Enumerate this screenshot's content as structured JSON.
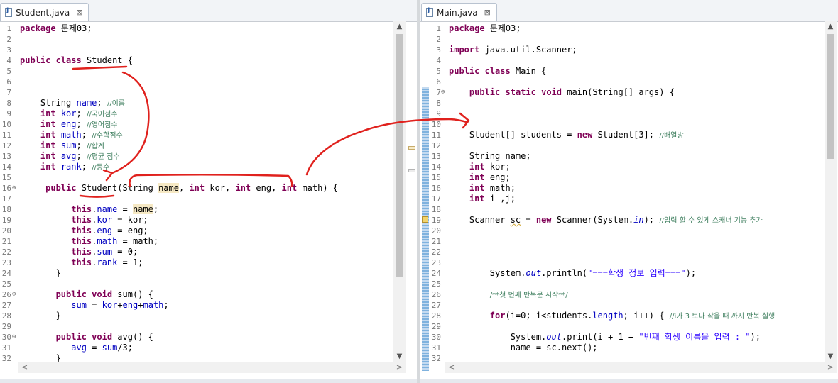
{
  "tabs": {
    "left": {
      "label": "Student.java",
      "close": "⊠"
    },
    "right": {
      "label": "Main.java",
      "close": "⊠"
    }
  },
  "icons": {
    "file": "java-file-icon",
    "close": "close-icon",
    "scroll_up": "▲",
    "scroll_down": "▼",
    "scroll_left": "<",
    "scroll_right": ">"
  },
  "colors": {
    "keyword": "#7f0055",
    "field": "#0000c0",
    "comment": "#3f7f5f",
    "string": "#2a00ff",
    "annotation": "#e0211d",
    "current_line": "#e8f2fe"
  },
  "left_editor": {
    "lines": [
      {
        "n": "1",
        "html": "<span class=\"kw\">package</span> 문제03;"
      },
      {
        "n": "2",
        "html": ""
      },
      {
        "n": "3",
        "html": ""
      },
      {
        "n": "4",
        "html": "<span class=\"kw\">public</span> <span class=\"kw\">class</span> Student {"
      },
      {
        "n": "5",
        "html": ""
      },
      {
        "n": "6",
        "html": ""
      },
      {
        "n": "7",
        "html": ""
      },
      {
        "n": "8",
        "html": "    String <span class=\"field\">name</span>; <span class=\"cmt\">//이름</span>"
      },
      {
        "n": "9",
        "html": "    <span class=\"kw\">int</span> <span class=\"field\">kor</span>; <span class=\"cmt\">//국어점수</span>"
      },
      {
        "n": "10",
        "html": "    <span class=\"kw\">int</span> <span class=\"field\">eng</span>; <span class=\"cmt\">//영어점수</span>"
      },
      {
        "n": "11",
        "html": "    <span class=\"kw\">int</span> <span class=\"field\">math</span>; <span class=\"cmt\">//수학점수</span>"
      },
      {
        "n": "12",
        "html": "    <span class=\"kw\">int</span> <span class=\"field\">sum</span>; <span class=\"cmt\">//합계</span>"
      },
      {
        "n": "13",
        "html": "    <span class=\"kw\">int</span> <span class=\"field\">avg</span>; <span class=\"cmt\">//평균 점수</span>"
      },
      {
        "n": "14",
        "html": "    <span class=\"kw\">int</span> <span class=\"field\">rank</span>; <span class=\"cmt\">//등수</span>"
      },
      {
        "n": "15",
        "html": ""
      },
      {
        "n": "16",
        "fold": "⊖",
        "html": "     <span class=\"kw\">public</span> Student(String <span class=\"occ\">name</span>, <span class=\"kw\">int</span> kor, <span class=\"kw\">int</span> eng, <span class=\"kw\">int</span> math) {"
      },
      {
        "n": "17",
        "html": ""
      },
      {
        "n": "18",
        "current": true,
        "html": "          <span class=\"kw\">this</span>.<span class=\"field\">name</span> = <span class=\"occ\">name</span>;"
      },
      {
        "n": "19",
        "html": "          <span class=\"kw\">this</span>.<span class=\"field\">kor</span> = kor;"
      },
      {
        "n": "20",
        "html": "          <span class=\"kw\">this</span>.<span class=\"field\">eng</span> = eng;"
      },
      {
        "n": "21",
        "html": "          <span class=\"kw\">this</span>.<span class=\"field\">math</span> = math;"
      },
      {
        "n": "22",
        "html": "          <span class=\"kw\">this</span>.<span class=\"field\">sum</span> = 0;"
      },
      {
        "n": "23",
        "html": "          <span class=\"kw\">this</span>.<span class=\"field\">rank</span> = 1;"
      },
      {
        "n": "24",
        "html": "       }"
      },
      {
        "n": "25",
        "html": ""
      },
      {
        "n": "26",
        "fold": "⊖",
        "html": "       <span class=\"kw\">public</span> <span class=\"kw\">void</span> sum() {"
      },
      {
        "n": "27",
        "html": "          <span class=\"field\">sum</span> = <span class=\"field\">kor</span>+<span class=\"field\">eng</span>+<span class=\"field\">math</span>;"
      },
      {
        "n": "28",
        "html": "       }"
      },
      {
        "n": "29",
        "html": ""
      },
      {
        "n": "30",
        "fold": "⊖",
        "html": "       <span class=\"kw\">public</span> <span class=\"kw\">void</span> avg() {"
      },
      {
        "n": "31",
        "html": "          <span class=\"field\">avg</span> = <span class=\"field\">sum</span>/3;"
      },
      {
        "n": "32",
        "html": "       }"
      }
    ]
  },
  "right_editor": {
    "lines": [
      {
        "n": "1",
        "html": "<span class=\"kw\">package</span> 문제03;"
      },
      {
        "n": "2",
        "html": ""
      },
      {
        "n": "3",
        "html": "<span class=\"kw\">import</span> java.util.Scanner;"
      },
      {
        "n": "4",
        "html": ""
      },
      {
        "n": "5",
        "html": "<span class=\"kw\">public</span> <span class=\"kw\">class</span> Main {"
      },
      {
        "n": "6",
        "html": ""
      },
      {
        "n": "7",
        "fold": "⊖",
        "html": "    <span class=\"kw\">public</span> <span class=\"kw\">static</span> <span class=\"kw\">void</span> main(String[] args) {"
      },
      {
        "n": "8",
        "html": ""
      },
      {
        "n": "9",
        "html": ""
      },
      {
        "n": "10",
        "html": ""
      },
      {
        "n": "11",
        "html": "    Student[] students = <span class=\"kw\">new</span> Student[3]; <span class=\"cmt\">//배열방</span>"
      },
      {
        "n": "12",
        "html": ""
      },
      {
        "n": "13",
        "html": "    String name;"
      },
      {
        "n": "14",
        "html": "    <span class=\"kw\">int</span> kor;"
      },
      {
        "n": "15",
        "html": "    <span class=\"kw\">int</span> eng;"
      },
      {
        "n": "16",
        "html": "    <span class=\"kw\">int</span> math;"
      },
      {
        "n": "17",
        "current": true,
        "html": "    <span class=\"kw\">int</span> i ,j;"
      },
      {
        "n": "18",
        "html": ""
      },
      {
        "n": "19",
        "warn": true,
        "html": "    Scanner <span class=\"warn\">sc</span> = <span class=\"kw\">new</span> Scanner(System.<span class=\"static\">in</span>); <span class=\"cmt\">//입력 할 수 있게 스캐너 기능 추가</span>"
      },
      {
        "n": "20",
        "html": ""
      },
      {
        "n": "21",
        "html": ""
      },
      {
        "n": "22",
        "html": ""
      },
      {
        "n": "23",
        "html": ""
      },
      {
        "n": "24",
        "html": "        System.<span class=\"static\">out</span>.println(<span class=\"str\">\"===학생 정보 입력===\"</span>);"
      },
      {
        "n": "25",
        "html": ""
      },
      {
        "n": "26",
        "html": "        <span class=\"cmt\">/**첫 번째 반복문 시작**/</span>"
      },
      {
        "n": "27",
        "html": ""
      },
      {
        "n": "28",
        "html": "        <span class=\"kw\">for</span>(i=0; i&lt;students.<span class=\"field\">length</span>; i++) { <span class=\"cmt\">//i가 3 보다 작을 때 까지 반복 실행</span>"
      },
      {
        "n": "29",
        "html": ""
      },
      {
        "n": "30",
        "html": "            System.<span class=\"static\">out</span>.print(i + 1 + <span class=\"str\">\"번째 학생 이름을 입력 : \"</span>);"
      },
      {
        "n": "31",
        "html": "            name = sc.next();"
      },
      {
        "n": "32",
        "html": ""
      }
    ]
  }
}
